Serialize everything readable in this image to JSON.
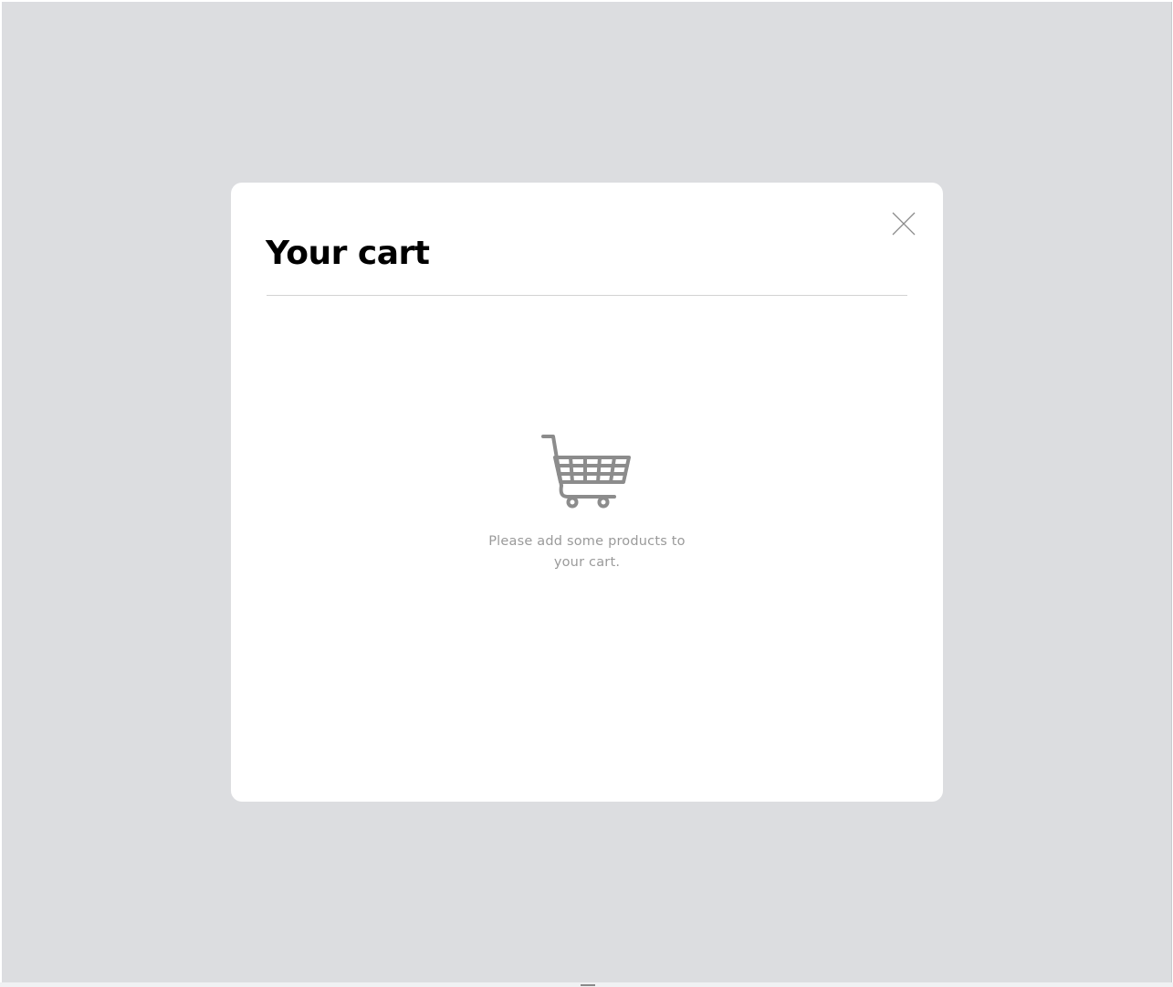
{
  "cart_modal": {
    "title": "Your cart",
    "close_icon": "close-icon",
    "empty_icon": "shopping-cart-icon",
    "empty_message": "Please add some products to your cart."
  },
  "colors": {
    "overlay": "#dcdde0",
    "modal_background": "#ffffff",
    "title": "#000000",
    "icon_gray": "#8c8c8c",
    "message_text": "#9a9a9a"
  }
}
